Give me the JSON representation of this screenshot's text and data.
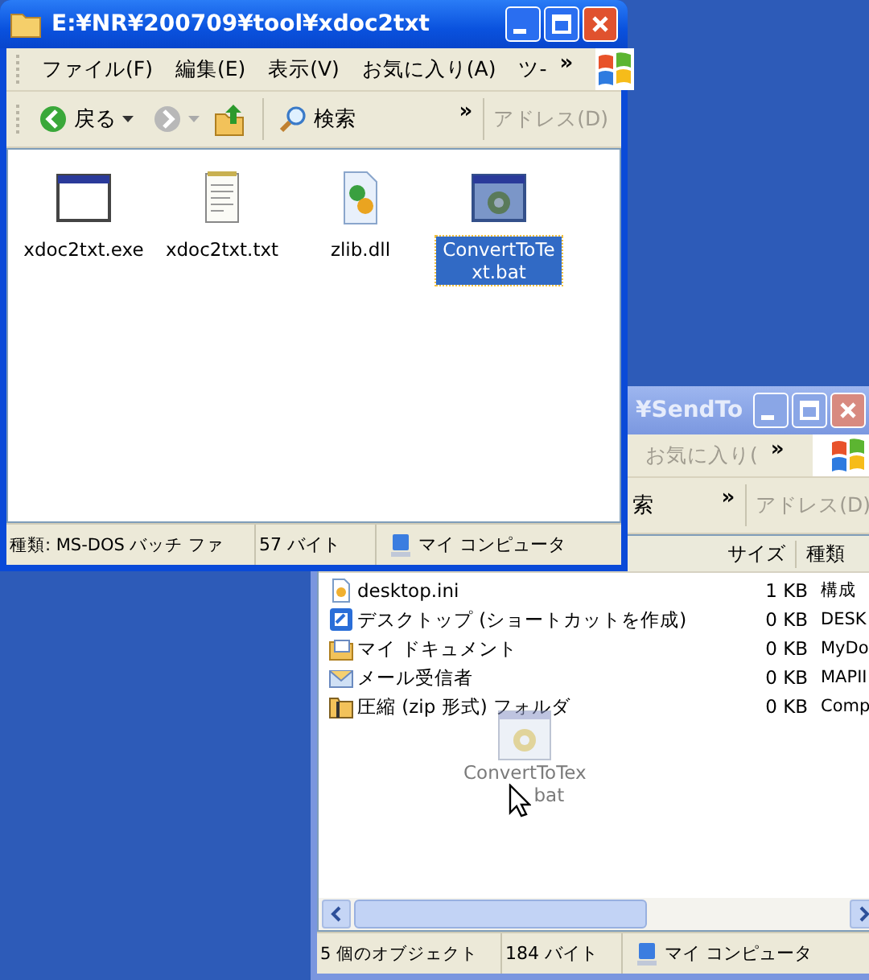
{
  "back_window": {
    "title": "¥SendTo",
    "active": false,
    "menu": [
      "お気に入り("
    ],
    "menu_more": "»",
    "toolbar": {
      "search": "索",
      "more": "»",
      "address": "アドレス(D)"
    },
    "columns": [
      "サイズ",
      "種類"
    ],
    "rows": [
      {
        "name": "desktop.ini",
        "size": "1 KB",
        "type": "構成",
        "kind": "ini"
      },
      {
        "name": "デスクトップ (ショートカットを作成)",
        "size": "0 KB",
        "type": "DESK",
        "kind": "desktop"
      },
      {
        "name": "マイ ドキュメント",
        "size": "0 KB",
        "type": "MyDo",
        "kind": "docs"
      },
      {
        "name": "メール受信者",
        "size": "0 KB",
        "type": "MAPII",
        "kind": "mail"
      },
      {
        "name": "圧縮 (zip 形式) フォルダ",
        "size": "0 KB",
        "type": "Comp",
        "kind": "zip"
      }
    ],
    "drag": {
      "lines": [
        "ConvertToTex",
        "bat"
      ]
    },
    "status": [
      "5 個のオブジェクト",
      "184 バイト",
      "マイ コンピュータ"
    ]
  },
  "front_window": {
    "title": "E:¥NR¥200709¥tool¥xdoc2txt",
    "active": true,
    "menu": [
      "ファイル(F)",
      "編集(E)",
      "表示(V)",
      "お気に入り(A)",
      "ツ-"
    ],
    "menu_more": "»",
    "toolbar": {
      "back": "戻る",
      "search": "検索",
      "more": "»",
      "address": "アドレス(D)"
    },
    "files": [
      {
        "name": "xdoc2txt.exe",
        "kind": "exe",
        "selected": false
      },
      {
        "name": "xdoc2txt.txt",
        "kind": "txt",
        "selected": false
      },
      {
        "name": "zlib.dll",
        "kind": "dll",
        "selected": false
      },
      {
        "name": "ConvertToText.bat",
        "kind": "bat",
        "selected": true
      }
    ],
    "status": [
      "種類: MS-DOS バッチ ファ",
      "57 バイト",
      "マイ コンピュータ"
    ]
  }
}
